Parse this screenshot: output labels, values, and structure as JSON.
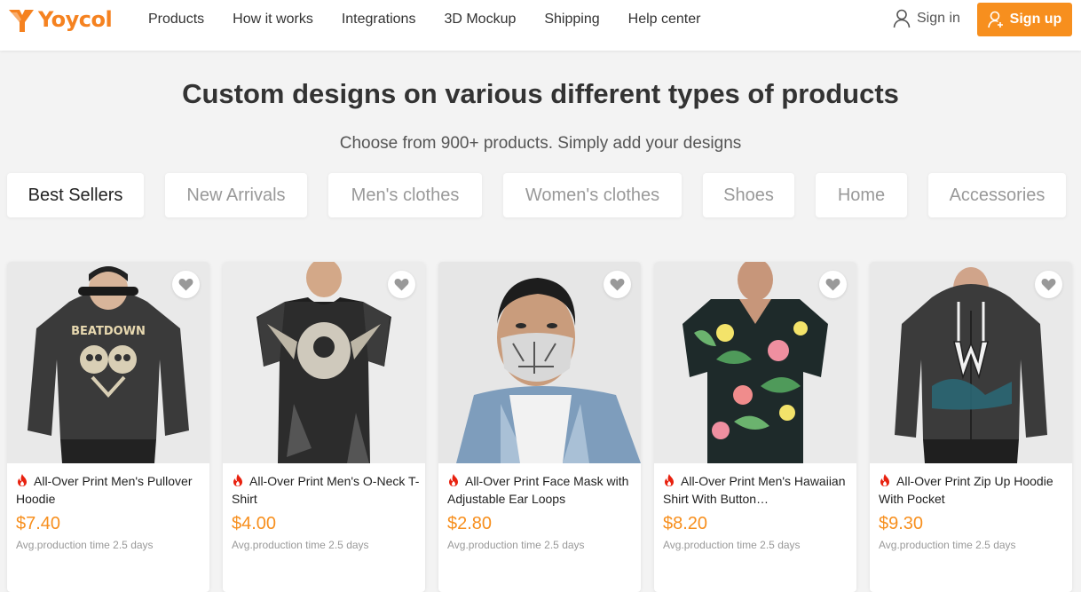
{
  "header": {
    "brand": "Yoycol",
    "nav": [
      "Products",
      "How it works",
      "Integrations",
      "3D Mockup",
      "Shipping",
      "Help center"
    ],
    "sign_in": "Sign in",
    "sign_up": "Sign up"
  },
  "hero": {
    "title": "Custom designs on various different types of products",
    "subtitle": "Choose from 900+ products. Simply add your designs"
  },
  "tabs": [
    "Best Sellers",
    "New Arrivals",
    "Men's clothes",
    "Women's clothes",
    "Shoes",
    "Home",
    "Accessories"
  ],
  "products": [
    {
      "name": "All-Over Print Men's Pullover Hoodie",
      "price": "$7.40",
      "time": "Avg.production time 2.5 days"
    },
    {
      "name": "All-Over Print Men's O-Neck T-Shirt",
      "price": "$4.00",
      "time": "Avg.production time 2.5 days"
    },
    {
      "name": "All-Over Print Face Mask with Adjustable Ear Loops",
      "price": "$2.80",
      "time": "Avg.production time 2.5 days"
    },
    {
      "name": "All-Over Print Men's Hawaiian Shirt With Button…",
      "price": "$8.20",
      "time": "Avg.production time 2.5 days"
    },
    {
      "name": "All-Over Print Zip Up Hoodie With Pocket",
      "price": "$9.30",
      "time": "Avg.production time 2.5 days"
    }
  ],
  "icons": {
    "logo": "yoycol-logo-icon",
    "sign_in": "user-icon",
    "sign_up": "user-add-icon",
    "favorite": "heart-icon",
    "hot": "fire-icon"
  },
  "colors": {
    "accent": "#f78f1e",
    "background": "#f3f3f3",
    "fire": "#e8210f"
  }
}
